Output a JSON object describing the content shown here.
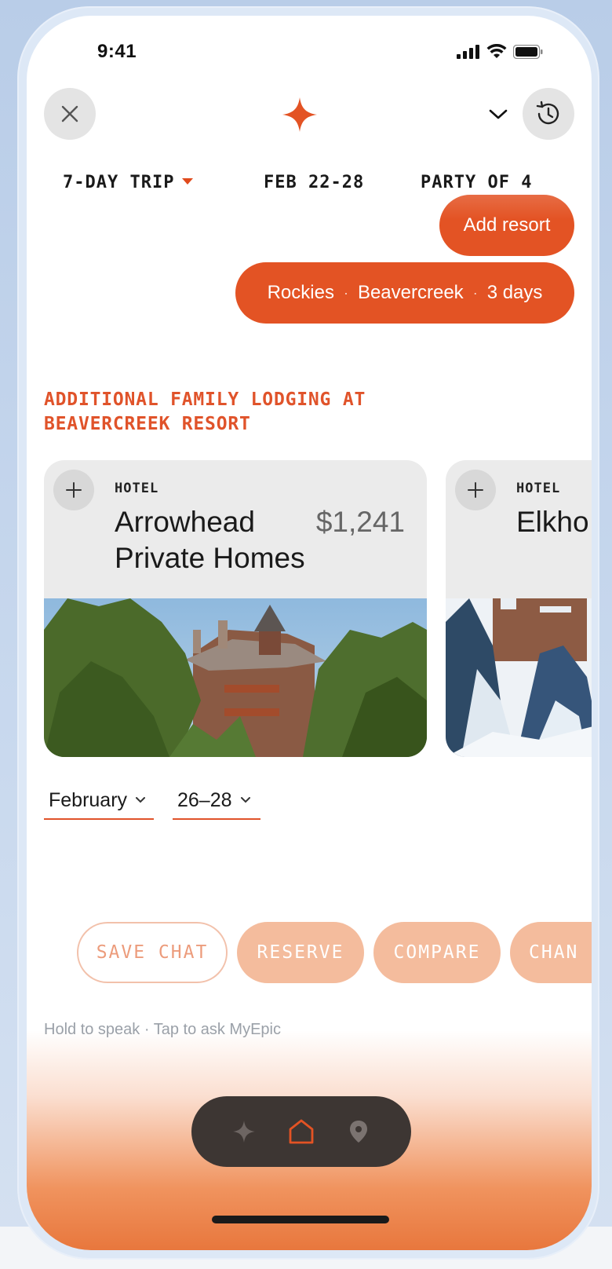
{
  "status": {
    "time": "9:41"
  },
  "header": {
    "close_icon": "close-icon",
    "logo_icon": "sparkle-icon",
    "dropdown_icon": "chevron-down-icon",
    "history_icon": "history-icon"
  },
  "trip": {
    "length": "7-DAY TRIP",
    "dates": "FEB 22-28",
    "party": "PARTY OF 4"
  },
  "chat": {
    "add_resort": "Add resort",
    "route": [
      "Rockies",
      "Beavercreek",
      "3 days"
    ],
    "separator": "·"
  },
  "section": {
    "heading": "ADDITIONAL FAMILY LODGING AT BEAVERCREEK RESORT"
  },
  "cards": [
    {
      "type": "HOTEL",
      "name": "Arrowhead\nPrivate Homes",
      "price": "$1,241"
    },
    {
      "type": "HOTEL",
      "name": "Elkho",
      "price": ""
    }
  ],
  "date_picker": {
    "month": "February",
    "days": "26–28"
  },
  "actions": {
    "save_chat": "SAVE CHAT",
    "reserve": "RESERVE",
    "compare": "COMPARE",
    "change": "CHAN"
  },
  "hint": "Hold to speak · Tap to ask MyEpic",
  "nav": {
    "items": [
      "sparkle-icon",
      "home-icon",
      "location-pin-icon"
    ],
    "active": "home-icon"
  },
  "colors": {
    "accent": "#e35324",
    "accent_light": "#f4bc9d",
    "nav_bg": "#3d3633"
  }
}
